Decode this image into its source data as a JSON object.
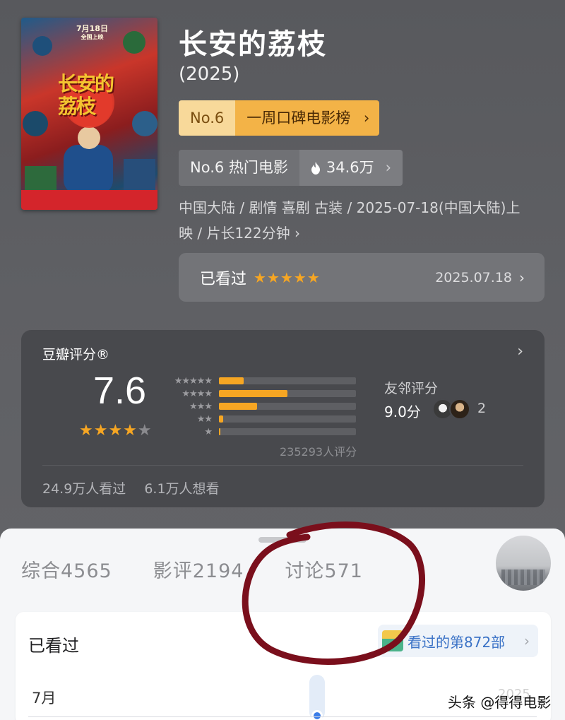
{
  "movie": {
    "title": "长安的荔枝",
    "year": "(2025)",
    "poster": {
      "date_text": "7月18日",
      "sub_text": "全国上映",
      "title_art": "长安的荔枝"
    },
    "weekly_rank": {
      "no": "No.6",
      "label": "一周口碑电影榜",
      "chevron": "›"
    },
    "hot_rank": {
      "no_label": "No.6 热门电影",
      "heat": "34.6万",
      "icon": "flame-icon",
      "chevron": "›"
    },
    "meta_line1": "中国大陆 / 剧情 喜剧 古装 / 2025-07-18(中国大陆)上",
    "meta_line2": "映 / 片长122分钟 ›",
    "watched": {
      "label": "已看过",
      "stars": "★★★★★",
      "date": "2025.07.18",
      "chevron": "›"
    }
  },
  "rating": {
    "header": "豆瓣评分®",
    "chevron": "›",
    "score": "7.6",
    "stars_filled": "★★★★",
    "stars_empty": "★",
    "distribution": [
      {
        "stars": "★★★★★",
        "fraction": 0.18
      },
      {
        "stars": "★★★★",
        "fraction": 0.5
      },
      {
        "stars": "★★★",
        "fraction": 0.28
      },
      {
        "stars": "★★",
        "fraction": 0.03
      },
      {
        "stars": "★",
        "fraction": 0.01
      }
    ],
    "total": "235293人评分",
    "friends_label": "友邻评分",
    "friends_score": "9.0分",
    "friends_count": "2",
    "watched_count": "24.9万人看过",
    "want_count": "6.1万人想看"
  },
  "sheet": {
    "tabs": [
      {
        "label": "综合4565"
      },
      {
        "label": "影评2194"
      },
      {
        "label": "讨论571"
      }
    ],
    "card_title": "已看过",
    "badge_text": "看过的第872部",
    "badge_chevron": "›",
    "month": "7月",
    "ghost_year": "2025"
  },
  "watermarks": {
    "right": "头条 @得得电影",
    "left_line1": "",
    "left_line2": ""
  },
  "colors": {
    "accent_star": "#f6a623",
    "rank_gold": "#f3b347",
    "link_blue": "#3a72c6",
    "annotation_red": "#7a0f1c"
  }
}
